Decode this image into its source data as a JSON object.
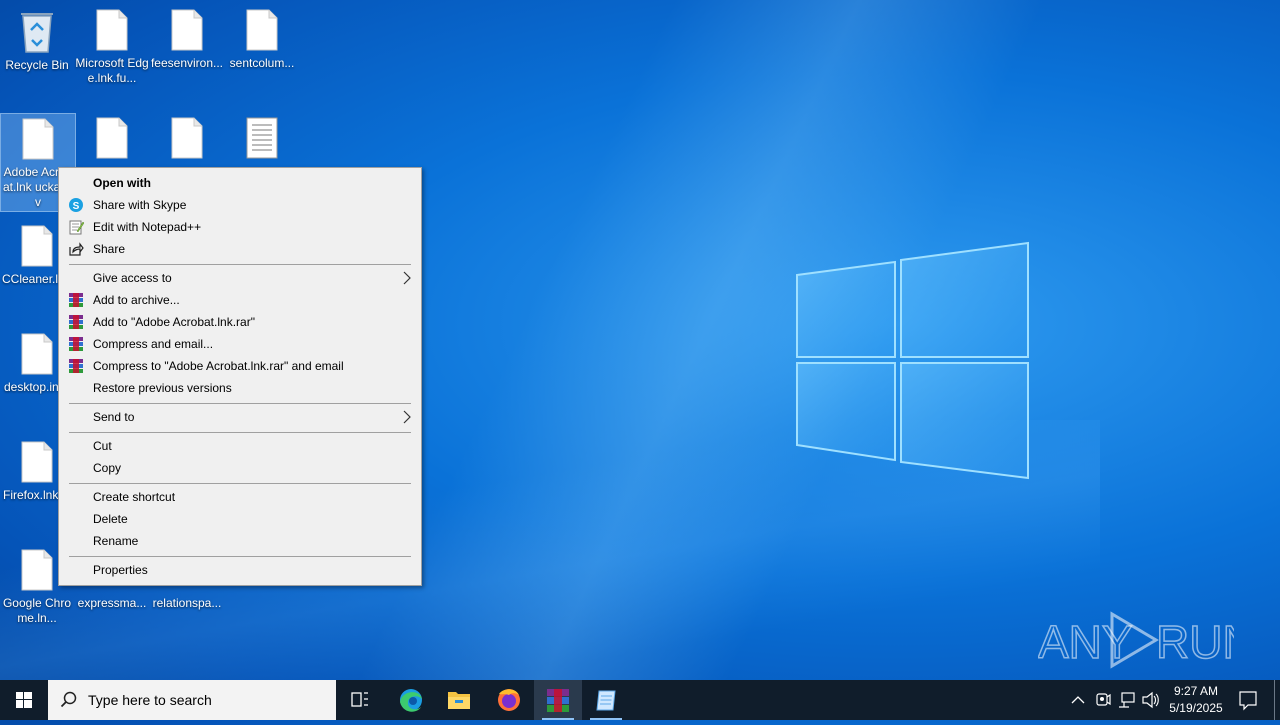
{
  "desktop": {
    "icons": [
      {
        "label": "Recycle Bin"
      },
      {
        "label": "Microsoft Edge.lnk.fu..."
      },
      {
        "label": "feesenviron..."
      },
      {
        "label": "sentcolum..."
      },
      {
        "label": "Adobe Acrobat.lnk uckazov"
      },
      {
        "label": "CCleaner.l"
      },
      {
        "label": "desktop.in"
      },
      {
        "label": "Firefox.lnk"
      },
      {
        "label": "Google Chrome.ln..."
      },
      {
        "label": "expressma..."
      },
      {
        "label": "relationspa..."
      }
    ]
  },
  "context_menu": {
    "items": [
      {
        "label": "Open with",
        "bold": true
      },
      {
        "label": "Share with Skype",
        "icon": "skype-icon"
      },
      {
        "label": "Edit with Notepad++",
        "icon": "notepadpp-icon"
      },
      {
        "label": "Share",
        "icon": "share-icon"
      },
      {
        "label": "Give access to",
        "submenu": true
      },
      {
        "label": "Add to archive...",
        "icon": "winrar-icon"
      },
      {
        "label": "Add to \"Adobe Acrobat.lnk.rar\"",
        "icon": "winrar-icon"
      },
      {
        "label": "Compress and email...",
        "icon": "winrar-icon"
      },
      {
        "label": "Compress to \"Adobe Acrobat.lnk.rar\" and email",
        "icon": "winrar-icon"
      },
      {
        "label": "Restore previous versions"
      },
      {
        "label": "Send to",
        "submenu": true
      },
      {
        "label": "Cut"
      },
      {
        "label": "Copy"
      },
      {
        "label": "Create shortcut"
      },
      {
        "label": "Delete"
      },
      {
        "label": "Rename"
      },
      {
        "label": "Properties"
      }
    ]
  },
  "taskbar": {
    "search_placeholder": "Type here to search",
    "apps": [
      "task-view-icon",
      "edge-icon",
      "file-explorer-icon",
      "firefox-icon",
      "winrar-icon",
      "notepad-icon"
    ],
    "clock": {
      "time": "9:27 AM",
      "date": "5/19/2025"
    }
  },
  "watermark": {
    "text": "ANY RUN"
  },
  "colors": {
    "accent": "#0a72d8",
    "menu_bg": "#f0f0f0",
    "taskbar_bg": "#101d2b"
  }
}
